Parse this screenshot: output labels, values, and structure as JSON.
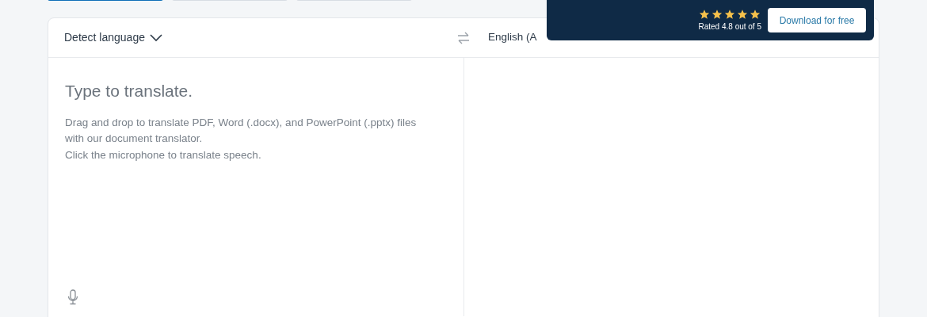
{
  "tabs": [
    {
      "selected": true
    },
    {
      "selected": false
    },
    {
      "selected": false
    }
  ],
  "source": {
    "language": "Detect language",
    "placeholder": "Type to translate.",
    "hints": [
      "Drag and drop to translate PDF, Word (.docx), and PowerPoint (.pptx) files with our document translator.",
      "Click the microphone to translate speech."
    ]
  },
  "target": {
    "language": "English (A"
  },
  "banner": {
    "stars": 5,
    "rating": "Rated 4.8 out of 5",
    "button": "Download for free"
  }
}
